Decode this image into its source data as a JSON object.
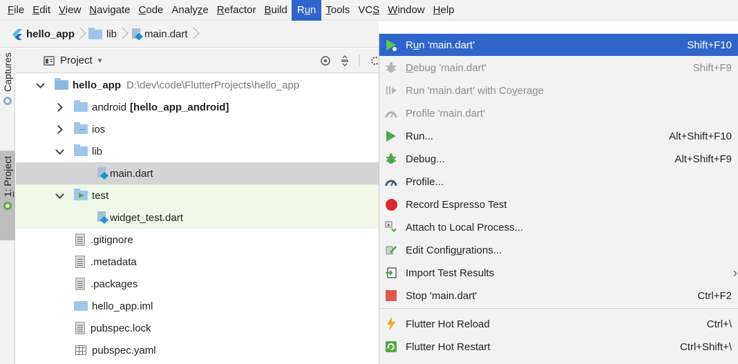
{
  "menubar": {
    "items": [
      {
        "name": "file",
        "mnemonic": "F",
        "rest": "ile"
      },
      {
        "name": "edit",
        "mnemonic": "E",
        "rest": "dit"
      },
      {
        "name": "view",
        "mnemonic": "V",
        "rest": "iew"
      },
      {
        "name": "navigate",
        "mnemonic": "N",
        "rest": "avigate"
      },
      {
        "name": "code",
        "mnemonic": "C",
        "rest": "ode"
      },
      {
        "name": "analyze",
        "pre": "Analy",
        "mnemonic": "z",
        "rest": "e"
      },
      {
        "name": "refactor",
        "mnemonic": "R",
        "rest": "efactor"
      },
      {
        "name": "build",
        "mnemonic": "B",
        "rest": "uild"
      },
      {
        "name": "run",
        "pre": "R",
        "mnemonic": "u",
        "rest": "n"
      },
      {
        "name": "tools",
        "mnemonic": "T",
        "rest": "ools"
      },
      {
        "name": "vcs",
        "pre": "VC",
        "mnemonic": "S",
        "rest": ""
      },
      {
        "name": "window",
        "mnemonic": "W",
        "rest": "indow"
      },
      {
        "name": "help",
        "mnemonic": "H",
        "rest": "elp"
      }
    ]
  },
  "navbar": {
    "crumbs": [
      "hello_app",
      "lib",
      "main.dart"
    ]
  },
  "strip": {
    "captures": "Captures",
    "project_num": "1",
    "project": ": Project"
  },
  "panel": {
    "title": "Project",
    "caret": "▾"
  },
  "tree": {
    "root_name": "hello_app",
    "root_path": "D:\\dev\\code\\FlutterProjects\\hello_app",
    "android": "android",
    "android_module": "[hello_app_android]",
    "ios": "ios",
    "lib": "lib",
    "main": "main.dart",
    "test": "test",
    "widget_test": "widget_test.dart",
    "gitignore": ".gitignore",
    "metadata": ".metadata",
    "packages": ".packages",
    "iml": "hello_app.iml",
    "pubspec_lock": "pubspec.lock",
    "pubspec_yaml": "pubspec.yaml"
  },
  "run_menu": {
    "run_main": {
      "pre": "R",
      "u": "u",
      "post": "n 'main.dart'",
      "shortcut": "Shift+F10"
    },
    "debug_main": {
      "pre": "",
      "u": "D",
      "post": "ebug 'main.dart'",
      "shortcut": "Shift+F9"
    },
    "coverage": {
      "pre": "Run 'main.dart' with Co",
      "u": "v",
      "post": "erage"
    },
    "profile_main": {
      "label": "Profile 'main.dart'"
    },
    "run": {
      "label": "Run...",
      "shortcut": "Alt+Shift+F10"
    },
    "debug": {
      "label": "Debug...",
      "shortcut": "Alt+Shift+F9"
    },
    "profile": {
      "label": "Profile..."
    },
    "record": {
      "label": "Record Espresso Test"
    },
    "attach": {
      "label": "Attach to Local Process..."
    },
    "edit_config": {
      "pre": "Edit Config",
      "u": "u",
      "post": "rations..."
    },
    "import": {
      "label": "Import Test Results",
      "arrow": "›"
    },
    "stop": {
      "label": "Stop 'main.dart'",
      "shortcut": "Ctrl+F2"
    },
    "hot_reload": {
      "label": "Flutter Hot Reload",
      "shortcut": "Ctrl+\\"
    },
    "hot_restart": {
      "label": "Flutter Hot Restart",
      "shortcut": "Ctrl+Shift+\\"
    }
  },
  "colors": {
    "highlight": "#2f65ca",
    "run_green": "#4fa84a",
    "record_red": "#d9282f"
  }
}
